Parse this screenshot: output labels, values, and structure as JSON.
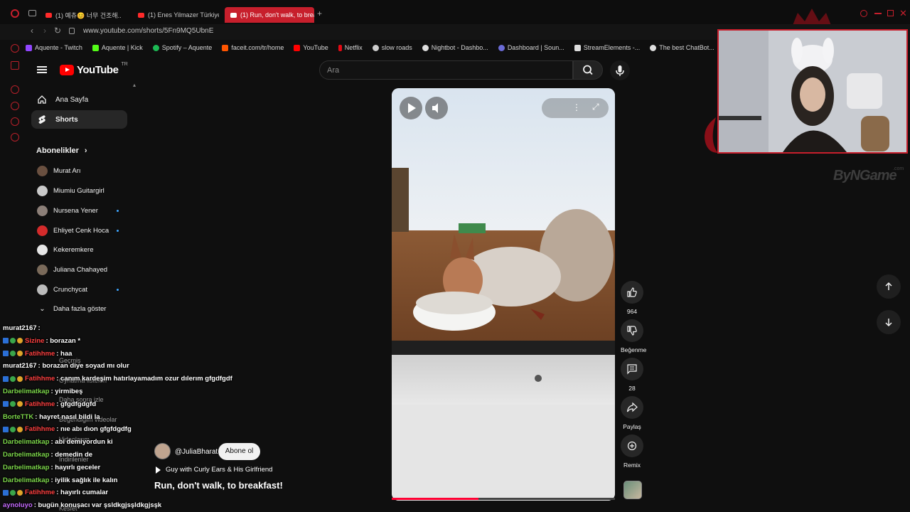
{
  "browser": {
    "tabs": [
      {
        "label": "(1) 예츄😊 너무 건조해.."
      },
      {
        "label": "(1) Enes Yilmazer Türkiye"
      },
      {
        "label": "(1) Run, don't walk, to brea"
      }
    ],
    "url": "www.youtube.com/shorts/5Fn9MQ5UbnE",
    "bookmarks": [
      {
        "label": "Aquente - Twitch",
        "color": "#9146ff"
      },
      {
        "label": "Aquente | Kick",
        "color": "#53fc18"
      },
      {
        "label": "Spotify – Aquente",
        "color": "#1db954"
      },
      {
        "label": "faceit.com/tr/home",
        "color": "#ff5500"
      },
      {
        "label": "YouTube",
        "color": "#ff0000"
      },
      {
        "label": "Netflix",
        "color": "#e50914"
      },
      {
        "label": "slow roads",
        "color": "#cccccc"
      },
      {
        "label": "Nightbot - Dashbo...",
        "color": "#dddddd"
      },
      {
        "label": "Dashboard | Soun...",
        "color": "#6b6bd6"
      },
      {
        "label": "StreamElements -...",
        "color": "#dddddd"
      },
      {
        "label": "The best ChatBot...",
        "color": "#dddddd"
      }
    ]
  },
  "youtube": {
    "logo_text": "YouTube",
    "country_code": "TR",
    "search_placeholder": "Ara"
  },
  "sidebar": {
    "main": [
      {
        "label": "Ana Sayfa"
      },
      {
        "label": "Shorts"
      }
    ],
    "subscriptions_heading": "Abonelikler",
    "subscriptions": [
      {
        "name": "Murat Arı",
        "color": "#6a5040",
        "live": false
      },
      {
        "name": "Miumiu Guitargirl",
        "color": "#c9c9c9",
        "live": false
      },
      {
        "name": "Nursena Yener",
        "color": "#8c7f78",
        "live": true
      },
      {
        "name": "Ehliyet Cenk Hoca",
        "color": "#d42b2b",
        "live": true
      },
      {
        "name": "Kekeremkere",
        "color": "#e6e6e6",
        "live": false
      },
      {
        "name": "Juliana Chahayed",
        "color": "#7a6a5a",
        "live": false
      },
      {
        "name": "Crunchycat",
        "color": "#bbbbbb",
        "live": true
      }
    ],
    "show_more": "Daha fazla göster",
    "ghost_items": [
      "Geçmiş",
      "Oynatma listeleri",
      "Daha sonra izle",
      "Beğendiğim videolar",
      "Videolarım",
      "İndirilenler",
      "Kesfet"
    ]
  },
  "chat": [
    {
      "user": "murat2167",
      "color": "#ffffff",
      "text": ": ",
      "badges": false
    },
    {
      "user": "Sizine",
      "color": "#ff4040",
      "text": ": borazan *",
      "badges": true
    },
    {
      "user": "Fatihhme",
      "color": "#ff4040",
      "text": ": haa",
      "badges": true
    },
    {
      "user": "murat2167",
      "color": "#ffffff",
      "text": ": borazan diye soyad mı olur",
      "badges": false
    },
    {
      "user": "Fatihhme",
      "color": "#ff4040",
      "text": ": canım kardeşim hatırlayamadım ozur dılerım gfgdfgdf",
      "badges": true
    },
    {
      "user": "Darbelimatkap",
      "color": "#7cd64a",
      "text": ": yirmibeş",
      "badges": false
    },
    {
      "user": "Fatihhme",
      "color": "#ff4040",
      "text": ": gfgdfgdgfd",
      "badges": true
    },
    {
      "user": "BorteTTK",
      "color": "#7cd64a",
      "text": ": hayret nasıl bildi la",
      "badges": false
    },
    {
      "user": "Fatihhme",
      "color": "#ff4040",
      "text": ": nıe abı dıon gfgfdgdfg",
      "badges": true
    },
    {
      "user": "Darbelimatkap",
      "color": "#7cd64a",
      "text": ": abi demiyordun ki",
      "badges": false
    },
    {
      "user": "Darbelimatkap",
      "color": "#7cd64a",
      "text": ": demedin de",
      "badges": false
    },
    {
      "user": "Darbelimatkap",
      "color": "#7cd64a",
      "text": ": hayırlı geceler",
      "badges": false
    },
    {
      "user": "Darbelimatkap",
      "color": "#7cd64a",
      "text": ": iyilik sağlık ile kalın",
      "badges": false
    },
    {
      "user": "Fatihhme",
      "color": "#ff4040",
      "text": ": hayırlı cumalar",
      "badges": true
    },
    {
      "user": "aynoluyo",
      "color": "#c66bff",
      "text": ": bugün konuşacı var şsldkgjsşldkgjsşk",
      "badges": false
    }
  ],
  "short": {
    "channel": "@JuliaBharat",
    "subscribe_label": "Abone ol",
    "song": "Guy with Curly Ears & His Girlfriend",
    "title": "Run, don't walk, to breakfast!",
    "progress_fraction": 0.39,
    "actions": {
      "like_count": "964",
      "dislike_label": "Beğenme",
      "comment_count": "28",
      "share_label": "Paylaş",
      "remix_label": "Remix"
    }
  },
  "watermark": "ByNGame",
  "watermark_domain": ".com",
  "colors": {
    "accent": "#c71f2c",
    "youtube_red": "#ff0000"
  }
}
